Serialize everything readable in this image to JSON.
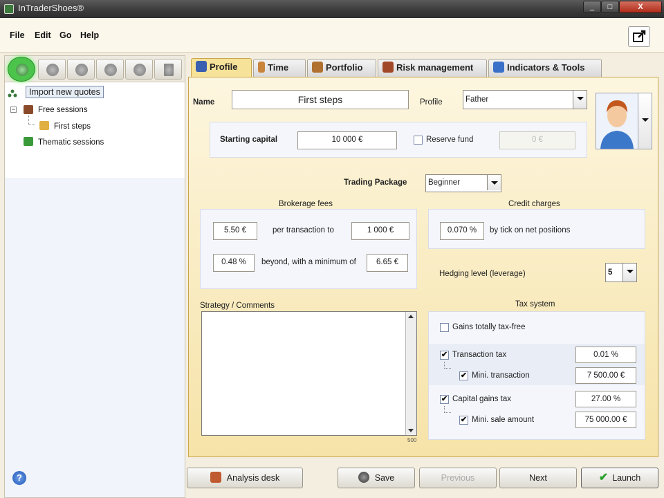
{
  "window": {
    "title": "InTraderShoes®",
    "min_glyph": "_",
    "max_glyph": "□",
    "close_glyph": "X"
  },
  "menu": [
    "File",
    "Edit",
    "Go",
    "Help"
  ],
  "toolbar": {
    "tooltip": "Import new quotes"
  },
  "tree": {
    "free_sessions": "Free sessions",
    "first_steps": "First steps",
    "thematic_sessions": "Thematic sessions"
  },
  "tabs": [
    "Profile",
    "Time",
    "Portfolio",
    "Risk management",
    "Indicators & Tools"
  ],
  "profile": {
    "name_label": "Name",
    "name_value": "First steps",
    "profile_label": "Profile",
    "profile_value": "Father",
    "starting_capital_label": "Starting capital",
    "starting_capital_value": "10 000 €",
    "reserve_fund_label": "Reserve fund",
    "reserve_fund_value": "0 €",
    "trading_package_label": "Trading Package",
    "trading_package_value": "Beginner"
  },
  "brokerage": {
    "title": "Brokerage fees",
    "fee1": "5.50 €",
    "per_transaction": "per transaction to",
    "limit": "1 000 €",
    "fee2": "0.48 %",
    "beyond": "beyond, with a minimum of",
    "minimum": "6.65 €"
  },
  "credit": {
    "title": "Credit charges",
    "rate": "0.070 %",
    "text": "by tick on net positions"
  },
  "hedging": {
    "label": "Hedging level (leverage)",
    "value": "5"
  },
  "strategy": {
    "label": "Strategy / Comments",
    "char_limit": "500"
  },
  "tax": {
    "title": "Tax system",
    "tax_free": "Gains totally tax-free",
    "transaction_tax": "Transaction tax",
    "transaction_tax_value": "0.01 %",
    "mini_transaction": "Mini. transaction",
    "mini_transaction_value": "7 500.00 €",
    "capital_gains_tax": "Capital gains tax",
    "capital_gains_value": "27.00 %",
    "mini_sale": "Mini. sale amount",
    "mini_sale_value": "75 000.00 €",
    "check_glyph": "✔"
  },
  "buttons": {
    "analysis_desk": "Analysis desk",
    "save": "Save",
    "previous": "Previous",
    "next": "Next",
    "launch": "Launch",
    "help": "?"
  },
  "colors": {
    "accent": "#f7e29a",
    "tab_border": "#c9a44c",
    "active_tool": "#4cc44c"
  }
}
